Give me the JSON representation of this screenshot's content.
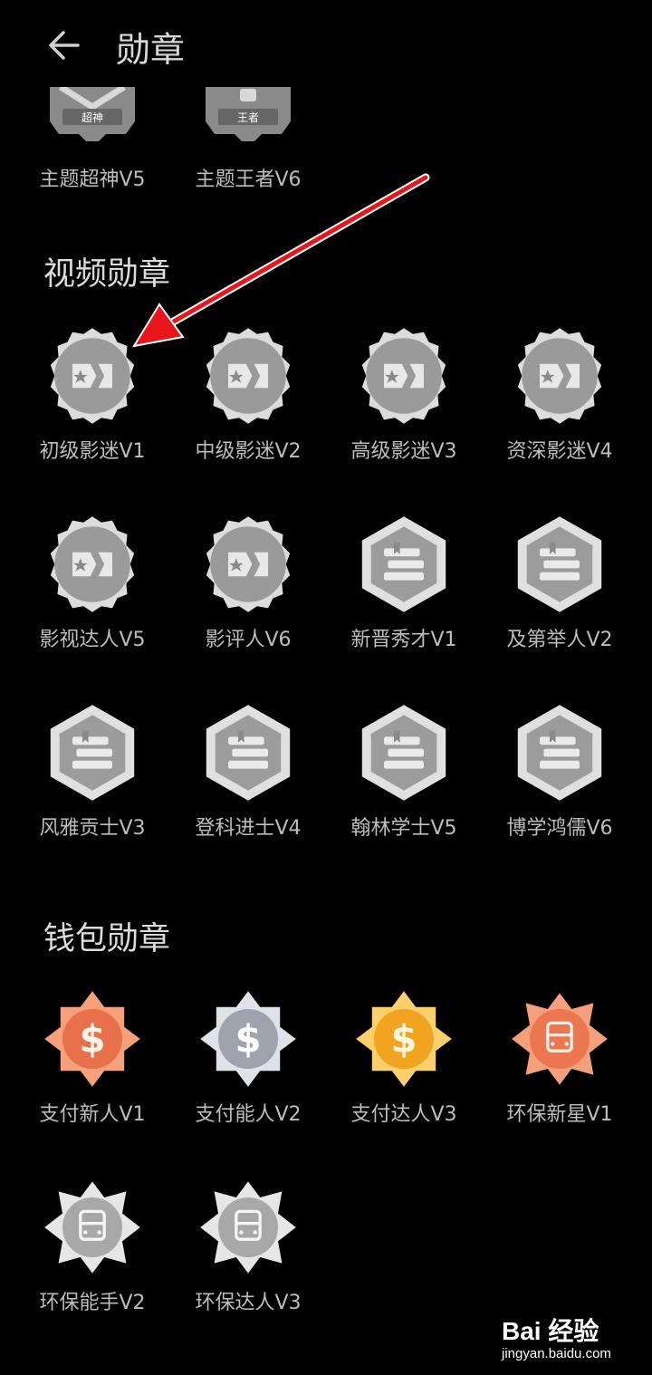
{
  "header": {
    "title": "勋章"
  },
  "top_row": [
    {
      "label": "主题超神V5",
      "text": "超神"
    },
    {
      "label": "主题王者V6",
      "text": "王者"
    }
  ],
  "sections": [
    {
      "title": "视频勋章",
      "badges": [
        {
          "label": "初级影迷V1",
          "icon": "film-icon"
        },
        {
          "label": "中级影迷V2",
          "icon": "film-icon"
        },
        {
          "label": "高级影迷V3",
          "icon": "film-icon"
        },
        {
          "label": "资深影迷V4",
          "icon": "film-icon"
        },
        {
          "label": "影视达人V5",
          "icon": "film-icon"
        },
        {
          "label": "影评人V6",
          "icon": "film-icon"
        },
        {
          "label": "新晋秀才V1",
          "icon": "books-icon"
        },
        {
          "label": "及第举人V2",
          "icon": "books-icon"
        },
        {
          "label": "风雅贡士V3",
          "icon": "books-icon"
        },
        {
          "label": "登科进士V4",
          "icon": "books-icon"
        },
        {
          "label": "翰林学士V5",
          "icon": "books-icon"
        },
        {
          "label": "博学鸿儒V6",
          "icon": "books-icon"
        }
      ]
    },
    {
      "title": "钱包勋章",
      "badges": [
        {
          "label": "支付新人V1",
          "icon": "dollar-icon",
          "color": "#f0825a"
        },
        {
          "label": "支付能人V2",
          "icon": "dollar-icon",
          "color": "#b8bcc4"
        },
        {
          "label": "支付达人V3",
          "icon": "dollar-icon",
          "color": "#f5b630"
        },
        {
          "label": "环保新星V1",
          "icon": "bus-icon",
          "color": "#f0825a"
        },
        {
          "label": "环保能手V2",
          "icon": "bus-icon",
          "color": "#c9c9c9"
        },
        {
          "label": "环保达人V3",
          "icon": "bus-icon",
          "color": "#c9c9c9"
        }
      ]
    }
  ],
  "watermark": {
    "brand": "Bai 经验",
    "site": "jingyan.baidu.com"
  }
}
